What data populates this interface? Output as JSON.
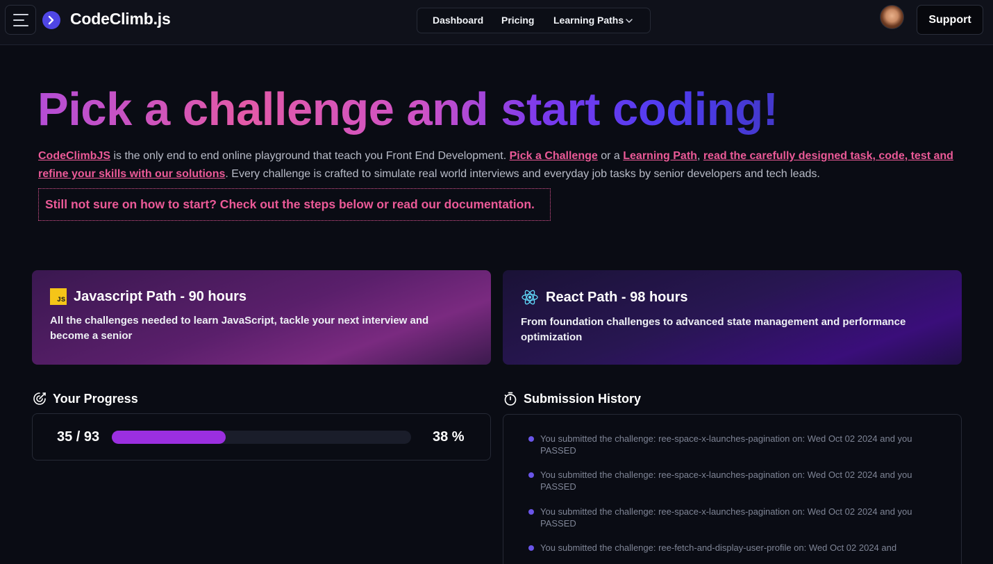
{
  "header": {
    "brand": "CodeClimb.js",
    "nav": [
      "Dashboard",
      "Pricing",
      "Learning Paths"
    ],
    "support_label": "Support"
  },
  "hero": {
    "title": "Pick a challenge and start coding!",
    "desc": {
      "link_brand": "CodeClimbJS",
      "text1": " is the only end to end online playground that teach you Front End Development. ",
      "link_challenge": "Pick a Challenge",
      "text2": " or a ",
      "link_path": "Learning Path",
      "text3": ", ",
      "link_task": "read the carefully designed task, code, test and refine your skills with our solutions",
      "text4": ". Every challenge is crafted to simulate real world interviews and everyday job tasks by senior developers and tech leads."
    },
    "hint": "Still not sure on how to start? Check out the steps below or read our documentation."
  },
  "paths": [
    {
      "badge": "JS",
      "title": "Javascript Path - 90 hours",
      "desc": "All the challenges needed to learn JavaScript, tackle your next interview and become a senior"
    },
    {
      "title": "React Path - 98 hours",
      "desc": "From foundation challenges to advanced state management and performance optimization"
    }
  ],
  "progress": {
    "title": "Your Progress",
    "count": "35 / 93",
    "fraction": 0.38,
    "percent": "38 %"
  },
  "history": {
    "title": "Submission History",
    "items": [
      "You submitted the challenge: ree-space-x-launches-pagination on: Wed Oct 02 2024 and you PASSED",
      "You submitted the challenge: ree-space-x-launches-pagination on: Wed Oct 02 2024 and you PASSED",
      "You submitted the challenge: ree-space-x-launches-pagination on: Wed Oct 02 2024 and you PASSED",
      "You submitted the challenge: ree-fetch-and-display-user-profile on: Wed Oct 02 2024 and"
    ]
  },
  "colors": {
    "accent": "#4f46e5",
    "pink": "#ec5a98",
    "progress": "#9b2fe0"
  }
}
